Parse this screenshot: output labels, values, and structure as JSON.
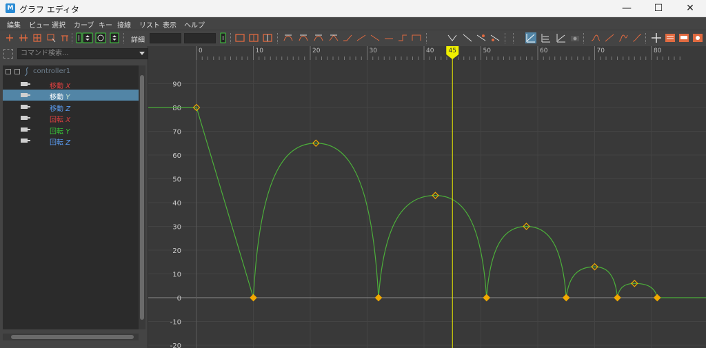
{
  "window": {
    "title": "グラフ エディタ",
    "app_icon": "M",
    "controls": {
      "minimize": "—",
      "maximize": "☐",
      "close": "✕"
    }
  },
  "menu": [
    "編集",
    "ビュー",
    "選択",
    "カーブ",
    "キー",
    "接線",
    "リスト",
    "表示",
    "ヘルプ"
  ],
  "toolbar": {
    "stats_label": "詳細",
    "accent": "#e0623a"
  },
  "outliner": {
    "search_placeholder": "コマンド検索...",
    "root": "controller1",
    "channels": [
      {
        "label": "移動",
        "axis": "X",
        "color": "#e04040",
        "selected": false
      },
      {
        "label": "移動",
        "axis": "Y",
        "color": "#ffffff",
        "axis_color": "#9be09b",
        "selected": true
      },
      {
        "label": "移動",
        "axis": "Z",
        "color": "#5b9bf0",
        "selected": false
      },
      {
        "label": "回転",
        "axis": "X",
        "color": "#e04040",
        "selected": false
      },
      {
        "label": "回転",
        "axis": "Y",
        "color": "#38c438",
        "selected": false
      },
      {
        "label": "回転",
        "axis": "Z",
        "color": "#5b9bf0",
        "selected": false
      }
    ]
  },
  "timeline": {
    "ticks": [
      0,
      10,
      20,
      30,
      40,
      50,
      60,
      70,
      80
    ],
    "current_frame": "45"
  },
  "chart_data": {
    "type": "line",
    "x_range": [
      0,
      85
    ],
    "y_ticks": [
      90,
      80,
      70,
      60,
      50,
      40,
      30,
      20,
      10,
      0,
      -10,
      -20
    ],
    "ylim": [
      -20,
      90
    ],
    "curve_color": "#4caf3a",
    "key_color": "#f0a800",
    "keys": [
      {
        "x": 0,
        "y": 80,
        "selected": false
      },
      {
        "x": 10,
        "y": 0,
        "selected": true
      },
      {
        "x": 21,
        "y": 65,
        "selected": false
      },
      {
        "x": 32,
        "y": 0,
        "selected": true
      },
      {
        "x": 42,
        "y": 43,
        "selected": false
      },
      {
        "x": 51,
        "y": 0,
        "selected": true
      },
      {
        "x": 58,
        "y": 30,
        "selected": false
      },
      {
        "x": 65,
        "y": 0,
        "selected": true
      },
      {
        "x": 70,
        "y": 13,
        "selected": false
      },
      {
        "x": 74,
        "y": 0,
        "selected": true
      },
      {
        "x": 77,
        "y": 6,
        "selected": false
      },
      {
        "x": 81,
        "y": 0,
        "selected": true
      }
    ]
  }
}
